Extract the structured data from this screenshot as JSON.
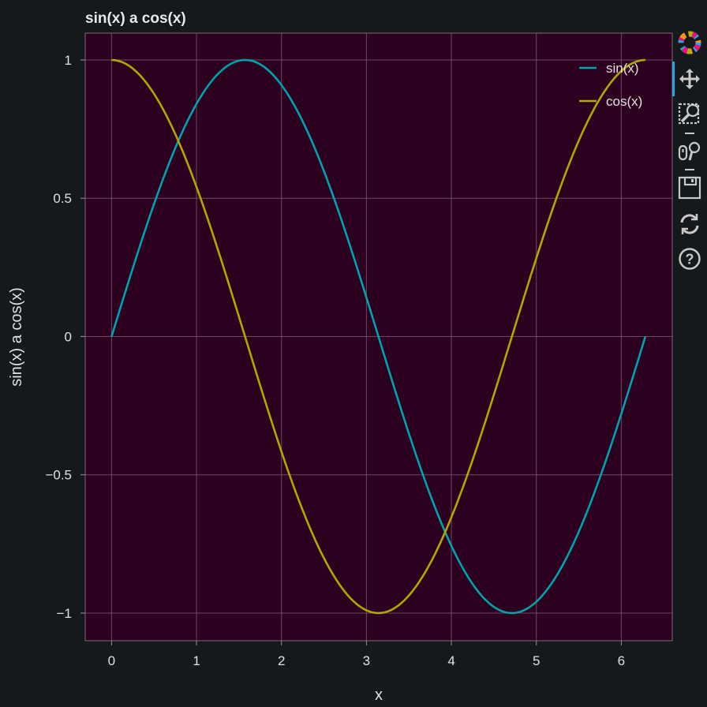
{
  "chart_data": {
    "type": "line",
    "title": "sin(x) a cos(x)",
    "xlabel": "x",
    "ylabel": "sin(x) a cos(x)",
    "xlim": [
      -0.31,
      6.6
    ],
    "ylim": [
      -1.1,
      1.097
    ],
    "xticks": [
      0,
      1,
      2,
      3,
      4,
      5,
      6
    ],
    "xtick_labels": [
      "0",
      "1",
      "2",
      "3",
      "4",
      "5",
      "6"
    ],
    "yticks": [
      -1,
      -0.5,
      0,
      0.5,
      1
    ],
    "ytick_labels": [
      "−1",
      "−0.5",
      "0",
      "0.5",
      "1"
    ],
    "grid": true,
    "legend_position": "top-right",
    "x_domain": [
      0,
      6.2832
    ],
    "num_points": 200,
    "series": [
      {
        "name": "sin(x)",
        "function": "sin",
        "color": "#00a3ab"
      },
      {
        "name": "cos(x)",
        "function": "cos",
        "color": "#b3a600"
      }
    ]
  },
  "colors": {
    "background": "#15191c",
    "plot_background": "#2d0020",
    "grid": "#7a5a70",
    "text": "#e0e0e0"
  },
  "toolbar": {
    "tools": [
      "bokeh-logo-icon",
      "pan-icon",
      "box-zoom-icon",
      "wheel-zoom-icon",
      "save-icon",
      "reset-icon",
      "help-icon"
    ]
  }
}
